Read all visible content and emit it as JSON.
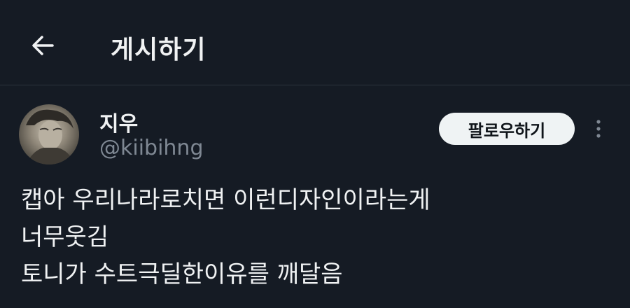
{
  "header": {
    "back_icon": "arrow-left-icon",
    "title": "게시하기"
  },
  "post": {
    "author": {
      "display_name": "지우",
      "handle": "@kiibihng",
      "avatar_icon": "avatar-photo"
    },
    "follow_label": "팔로우하기",
    "more_icon": "more-vertical-icon",
    "text_lines": [
      "캡아 우리나라로치면 이런디자인이라는게",
      "너무웃김",
      "토니가 수트극딜한이유를 깨달음"
    ]
  },
  "colors": {
    "background": "#151b24",
    "primary_text": "#f0f2f3",
    "secondary_text": "#7f8893",
    "follow_button_bg": "#eff3f4",
    "divider": "#2c333d"
  }
}
